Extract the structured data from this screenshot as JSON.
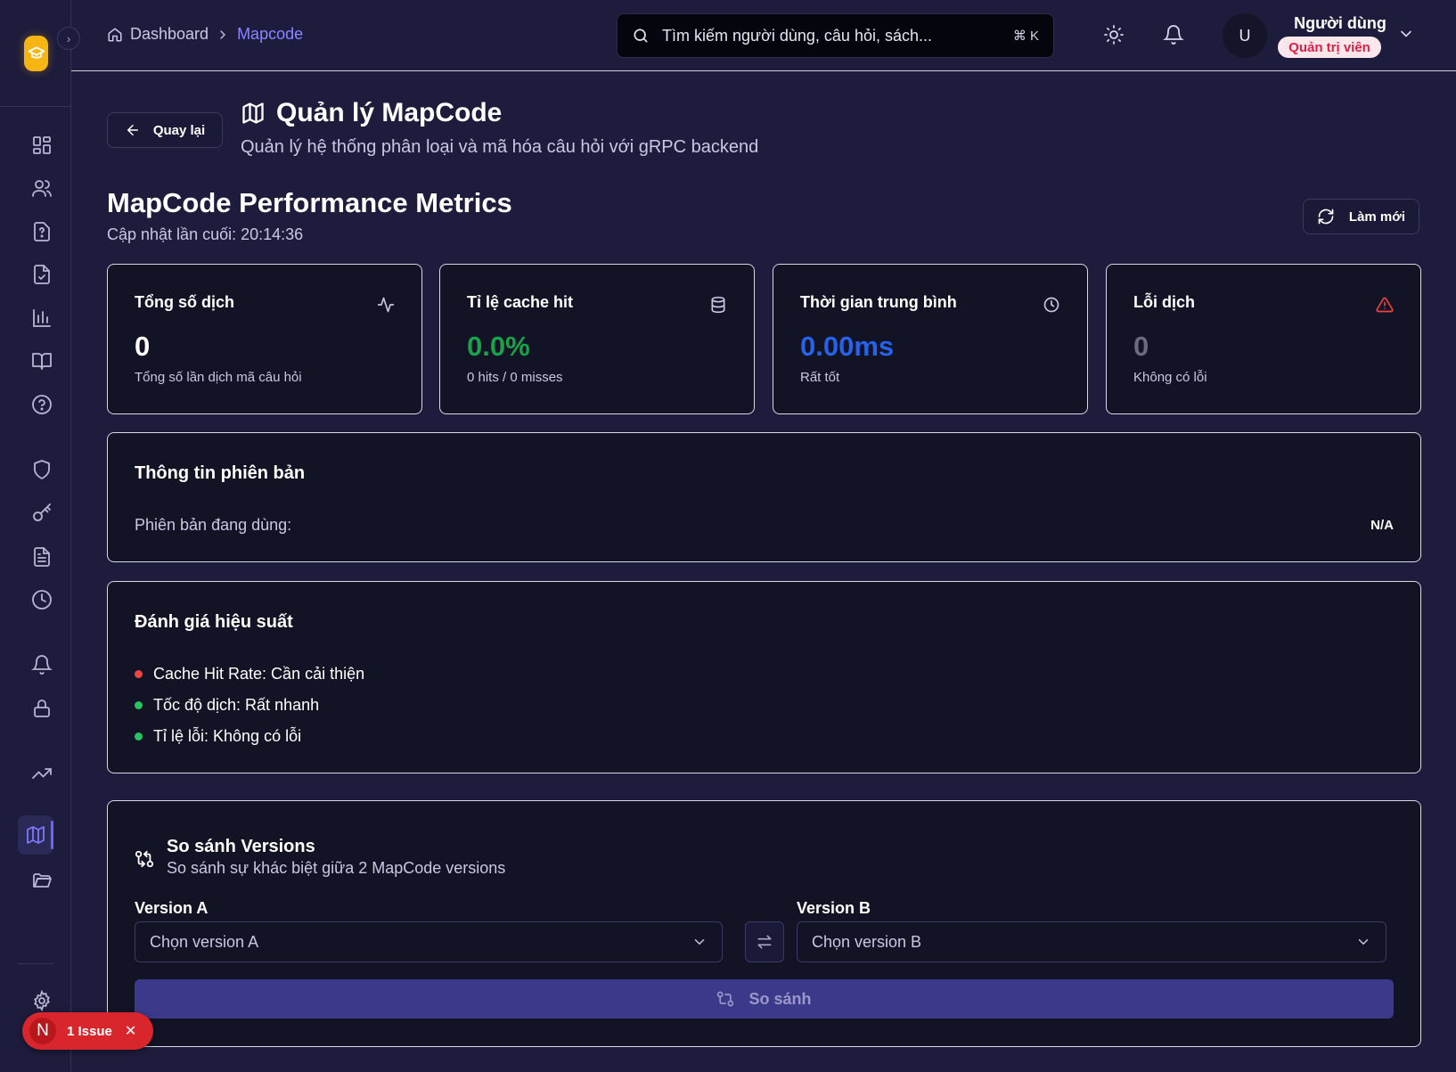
{
  "breadcrumb": {
    "home": "Dashboard",
    "current": "Mapcode"
  },
  "search": {
    "placeholder": "Tìm kiếm người dùng, câu hỏi, sách...",
    "shortcut": "⌘ K"
  },
  "user": {
    "initial": "U",
    "name": "Người dùng",
    "role": "Quản trị viên"
  },
  "page": {
    "back_label": "Quay lại",
    "title": "Quản lý MapCode",
    "subtitle": "Quản lý hệ thống phân loại và mã hóa câu hỏi với gRPC backend"
  },
  "metrics_section": {
    "title": "MapCode Performance Metrics",
    "updated": "Cập nhật lần cuối: 20:14:36",
    "refresh_label": "Làm mới"
  },
  "metrics": [
    {
      "label": "Tổng số dịch",
      "value": "0",
      "sub": "Tổng số lần dịch mã câu hỏi",
      "color": "#ffffff",
      "icon": "activity-icon"
    },
    {
      "label": "Tỉ lệ cache hit",
      "value": "0.0%",
      "sub": "0 hits / 0 misses",
      "color": "#16a34a",
      "icon": "database-icon"
    },
    {
      "label": "Thời gian trung bình",
      "value": "0.00ms",
      "sub": "Rất tốt",
      "color": "#2563eb",
      "icon": "clock-icon"
    },
    {
      "label": "Lỗi dịch",
      "value": "0",
      "sub": "Không có lỗi",
      "color": "#6b6b80",
      "icon": "alert-triangle-icon"
    }
  ],
  "version_info": {
    "title": "Thông tin phiên bản",
    "label": "Phiên bản đang dùng:",
    "value": "N/A"
  },
  "evaluation": {
    "title": "Đánh giá hiệu suất",
    "items": [
      {
        "text": "Cache Hit Rate: Cần cải thiện",
        "color": "#ef4444"
      },
      {
        "text": "Tốc độ dịch: Rất nhanh",
        "color": "#22c55e"
      },
      {
        "text": "Tỉ lệ lỗi: Không có lỗi",
        "color": "#22c55e"
      }
    ]
  },
  "compare": {
    "title": "So sánh Versions",
    "subtitle": "So sánh sự khác biệt giữa 2 MapCode versions",
    "version_a_label": "Version A",
    "version_a_placeholder": "Chọn version A",
    "version_b_label": "Version B",
    "version_b_placeholder": "Chọn version B",
    "button_label": "So sánh"
  },
  "issue_badge": {
    "letter": "N",
    "text": "1 Issue"
  }
}
